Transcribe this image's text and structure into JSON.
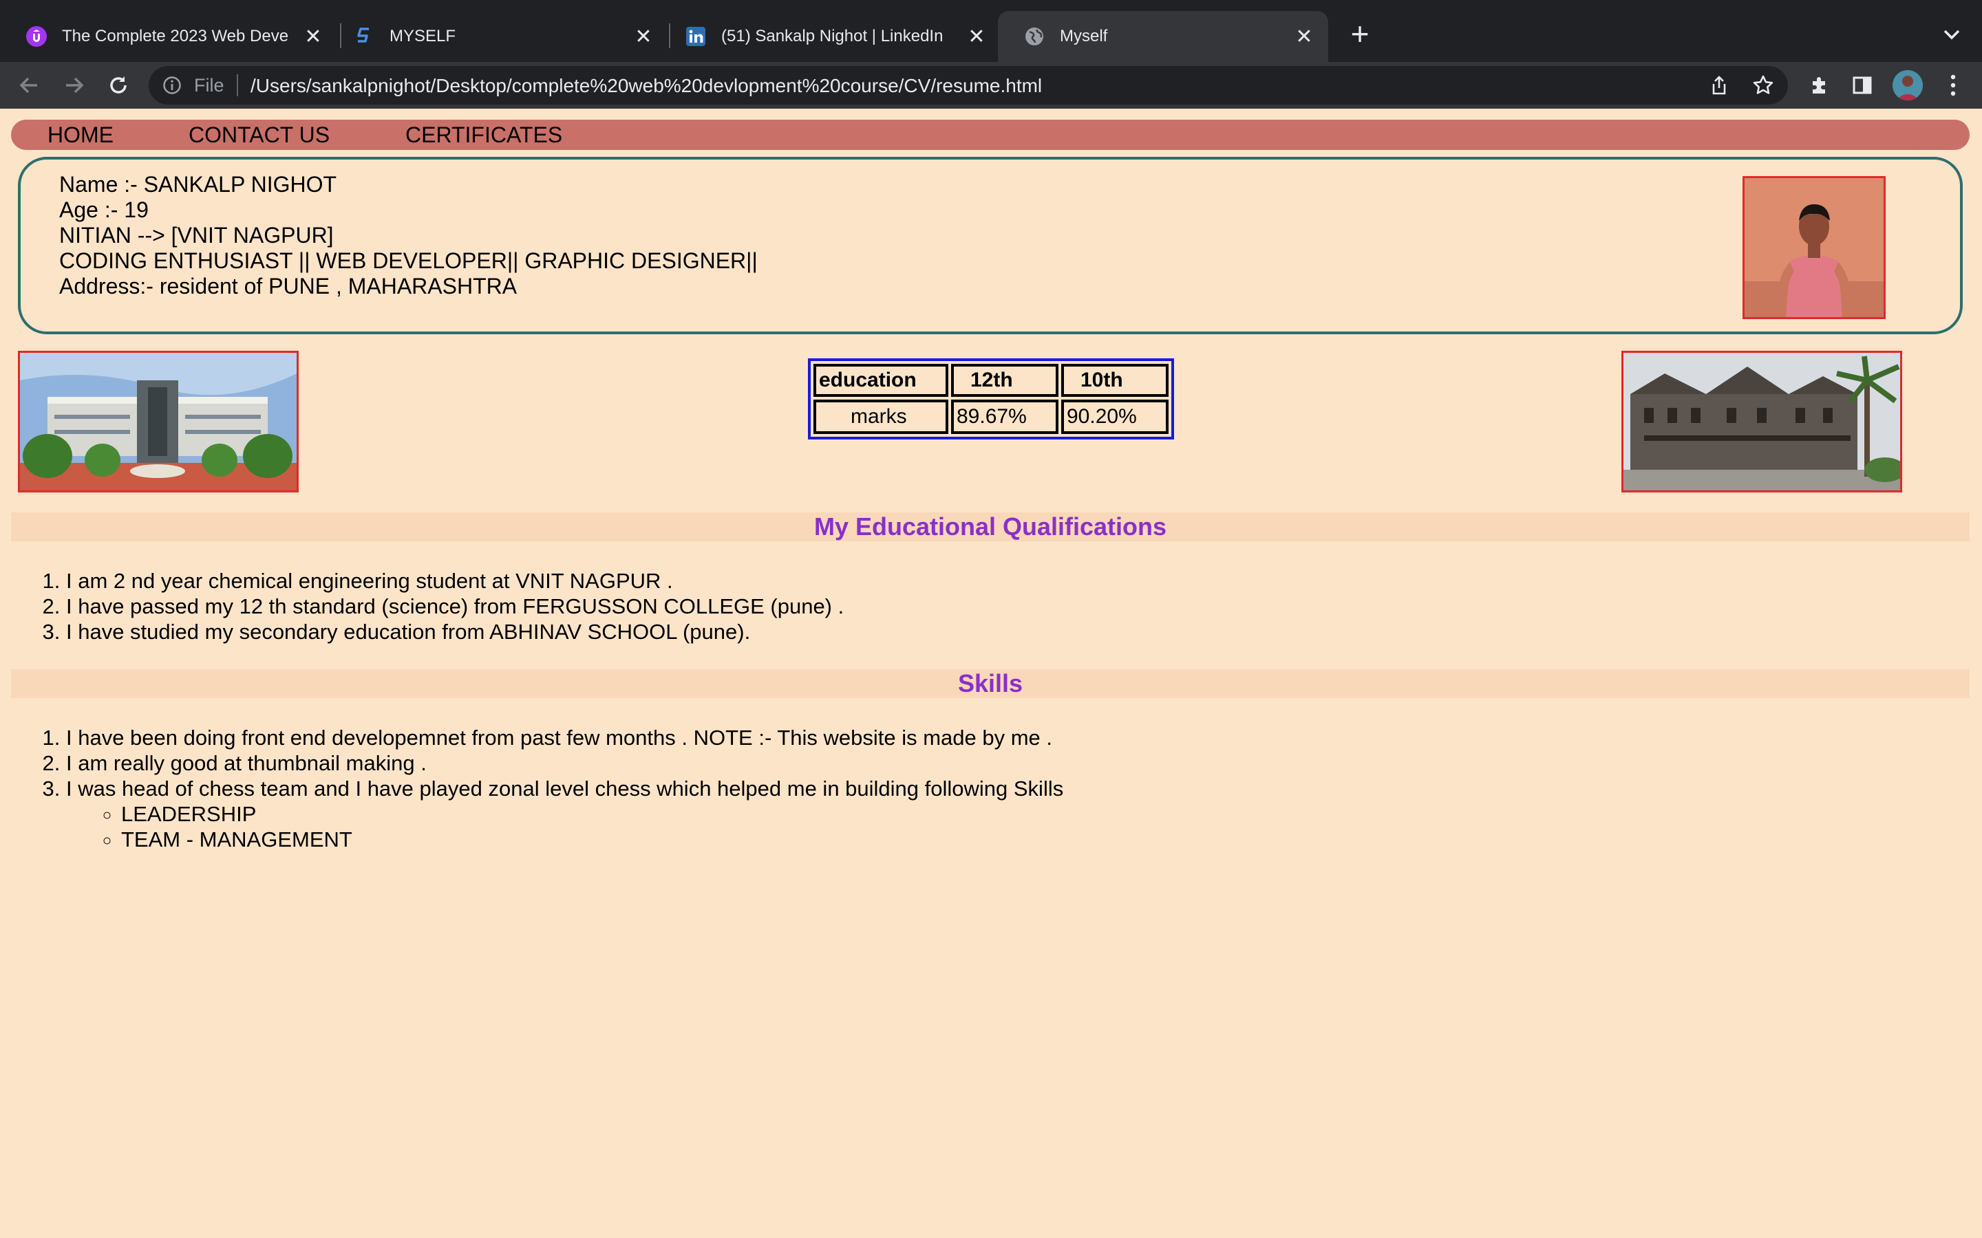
{
  "browser": {
    "tabs": [
      {
        "title": "The Complete 2023 Web Deve",
        "icon": "udemy-icon",
        "active": false
      },
      {
        "title": "MYSELF",
        "icon": "s-logo-icon",
        "active": false
      },
      {
        "title": "(51) Sankalp Nighot | LinkedIn",
        "icon": "linkedin-icon",
        "active": false
      },
      {
        "title": "Myself",
        "icon": "globe-icon",
        "active": true
      }
    ],
    "address": {
      "scheme_label": "File",
      "url": "/Users/sankalpnighot/Desktop/complete%20web%20devlopment%20course/CV/resume.html"
    }
  },
  "nav": {
    "items": [
      "HOME",
      "CONTACT US",
      "CERTIFICATES"
    ],
    "bg_color": "#c97068"
  },
  "profile": {
    "name": "Name :- SANKALP NIGHOT",
    "age": "Age :- 19",
    "institute": "NITIAN --> [VNIT NAGPUR]",
    "roles": "CODING ENTHUSIAST || WEB DEVELOPER|| GRAPHIC DESIGNER||",
    "address": "Address:- resident of PUNE , MAHARASHTRA"
  },
  "education_table": {
    "headers": [
      "education",
      "12th",
      "10th"
    ],
    "row": [
      "marks",
      "89.67%",
      "90.20%"
    ]
  },
  "qualifications": {
    "heading": "My Educational Qualifications",
    "items": [
      "I am 2 nd year chemical engineering student at VNIT NAGPUR .",
      "I have passed my 12 th standard (science) from FERGUSSON COLLEGE (pune) .",
      "I have studied my secondary education from ABHINAV SCHOOL (pune)."
    ]
  },
  "skills": {
    "heading": "Skills",
    "items": [
      "I have been doing front end developemnet from past few months . NOTE :- This website is made by me .",
      "I am really good at thumbnail making .",
      "I was head of chess team and I have played zonal level chess which helped me in building following Skills"
    ],
    "subitems": [
      "LEADERSHIP",
      "TEAM - MANAGEMENT"
    ]
  },
  "colors": {
    "page_bg": "#fce4c8",
    "heading": "#8b2fc9",
    "image_border": "#e02a2a",
    "table_border": "#1a1ae0",
    "card_border": "#2d6e6e"
  }
}
